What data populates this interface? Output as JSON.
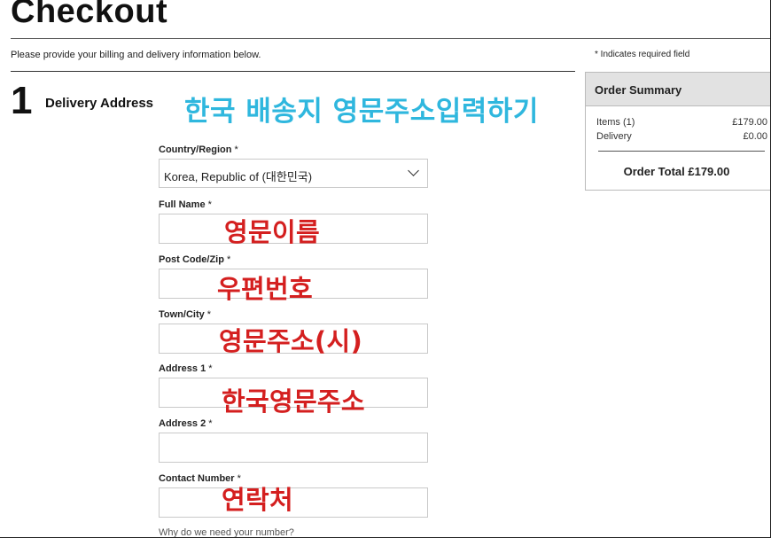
{
  "page": {
    "title": "Checkout",
    "subtitle": "Please provide your billing and delivery information below.",
    "required_note": "* Indicates required field"
  },
  "step": {
    "number": "1",
    "title": "Delivery Address"
  },
  "annotations": {
    "heading": "한국 배송지 영문주소입력하기",
    "full_name": "영문이름",
    "post_code": "우편번호",
    "town_city": "영문주소(시)",
    "address1": "한국영문주소",
    "contact": "연락처",
    "heading_color": "#2fb7de",
    "field_color": "#d41f1f"
  },
  "form": {
    "country": {
      "label": "Country/Region",
      "required": " *",
      "value": "Korea, Republic of (대한민국)"
    },
    "full_name": {
      "label": "Full Name",
      "required": " *",
      "value": ""
    },
    "post_code": {
      "label": "Post Code/Zip",
      "required": " *",
      "value": ""
    },
    "town_city": {
      "label": "Town/City",
      "required": " *",
      "value": ""
    },
    "address1": {
      "label": "Address 1",
      "required": " *",
      "value": ""
    },
    "address2": {
      "label": "Address 2",
      "required": " *",
      "value": ""
    },
    "contact": {
      "label": "Contact Number",
      "required": " *",
      "value": ""
    },
    "help_link": "Why do we need your number?"
  },
  "order_summary": {
    "title": "Order Summary",
    "items_label": "Items (1)",
    "items_value": "£179.00",
    "delivery_label": "Delivery",
    "delivery_value": "£0.00",
    "total": "Order Total £179.00"
  }
}
